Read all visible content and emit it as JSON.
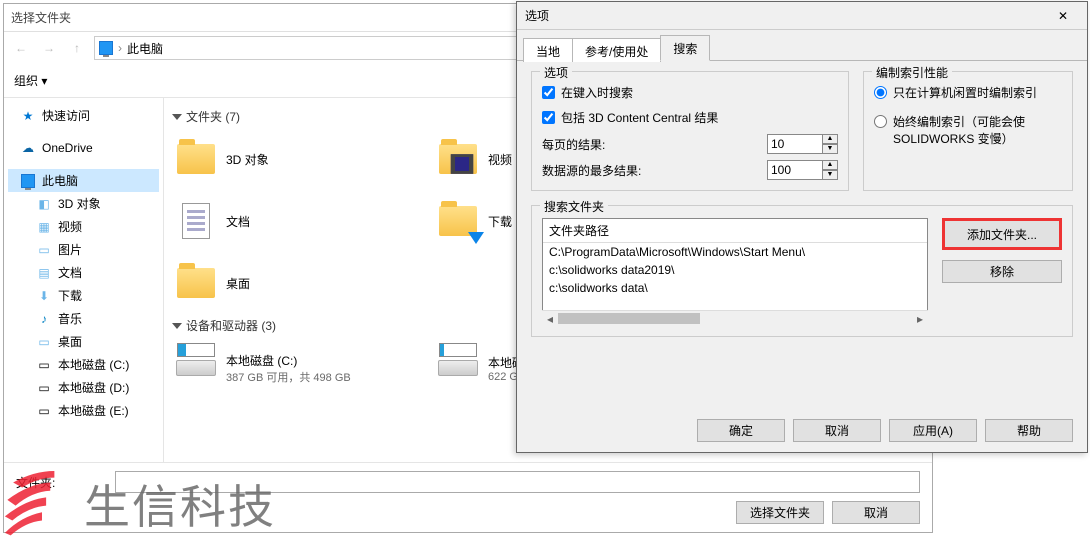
{
  "browse": {
    "title": "选择文件夹",
    "breadcrumb_here": "此电脑",
    "organize": "组织 ▾",
    "nav": {
      "quick": "快速访问",
      "onedrive": "OneDrive",
      "pc": "此电脑",
      "threed": "3D 对象",
      "video": "视频",
      "pictures": "图片",
      "docs": "文档",
      "downloads": "下载",
      "music": "音乐",
      "desktop": "桌面",
      "c": "本地磁盘 (C:)",
      "d": "本地磁盘 (D:)",
      "e": "本地磁盘 (E:)"
    },
    "group_folders": "文件夹 (7)",
    "group_drives": "设备和驱动器 (3)",
    "tiles": {
      "threed": "3D 对象",
      "docs": "文档",
      "desktop": "桌面",
      "video": "视频",
      "downloads": "下载"
    },
    "drive_c": "本地磁盘 (C:)",
    "drive_c_sub": "387 GB 可用，共 498 GB",
    "drive_other": "本地磁盘",
    "drive_other_sub": "622 G",
    "folder_label": "文件夹:",
    "select_btn": "选择文件夹",
    "cancel_btn": "取消"
  },
  "options": {
    "title": "选项",
    "tabs": {
      "local": "当地",
      "ref": "参考/使用处",
      "search": "搜索"
    },
    "grp_options": "选项",
    "chk_type": "在键入时搜索",
    "chk_3dcc": "包括 3D Content Central 结果",
    "res_per_page": "每页的结果:",
    "res_per_page_val": "10",
    "max_results": "数据源的最多结果:",
    "max_results_val": "100",
    "grp_index": "编制索引性能",
    "radio_idle": "只在计算机闲置时编制索引",
    "radio_always": "始终编制索引（可能会使 SOLIDWORKS 变慢）",
    "grp_search": "搜索文件夹",
    "col_path": "文件夹路径",
    "paths": [
      "C:\\ProgramData\\Microsoft\\Windows\\Start Menu\\",
      "c:\\solidworks data2019\\",
      "c:\\solidworks data\\"
    ],
    "add_folder": "添加文件夹...",
    "remove": "移除",
    "ok": "确定",
    "cancel": "取消",
    "apply": "应用(A)",
    "help": "帮助"
  },
  "watermark": "生信科技"
}
